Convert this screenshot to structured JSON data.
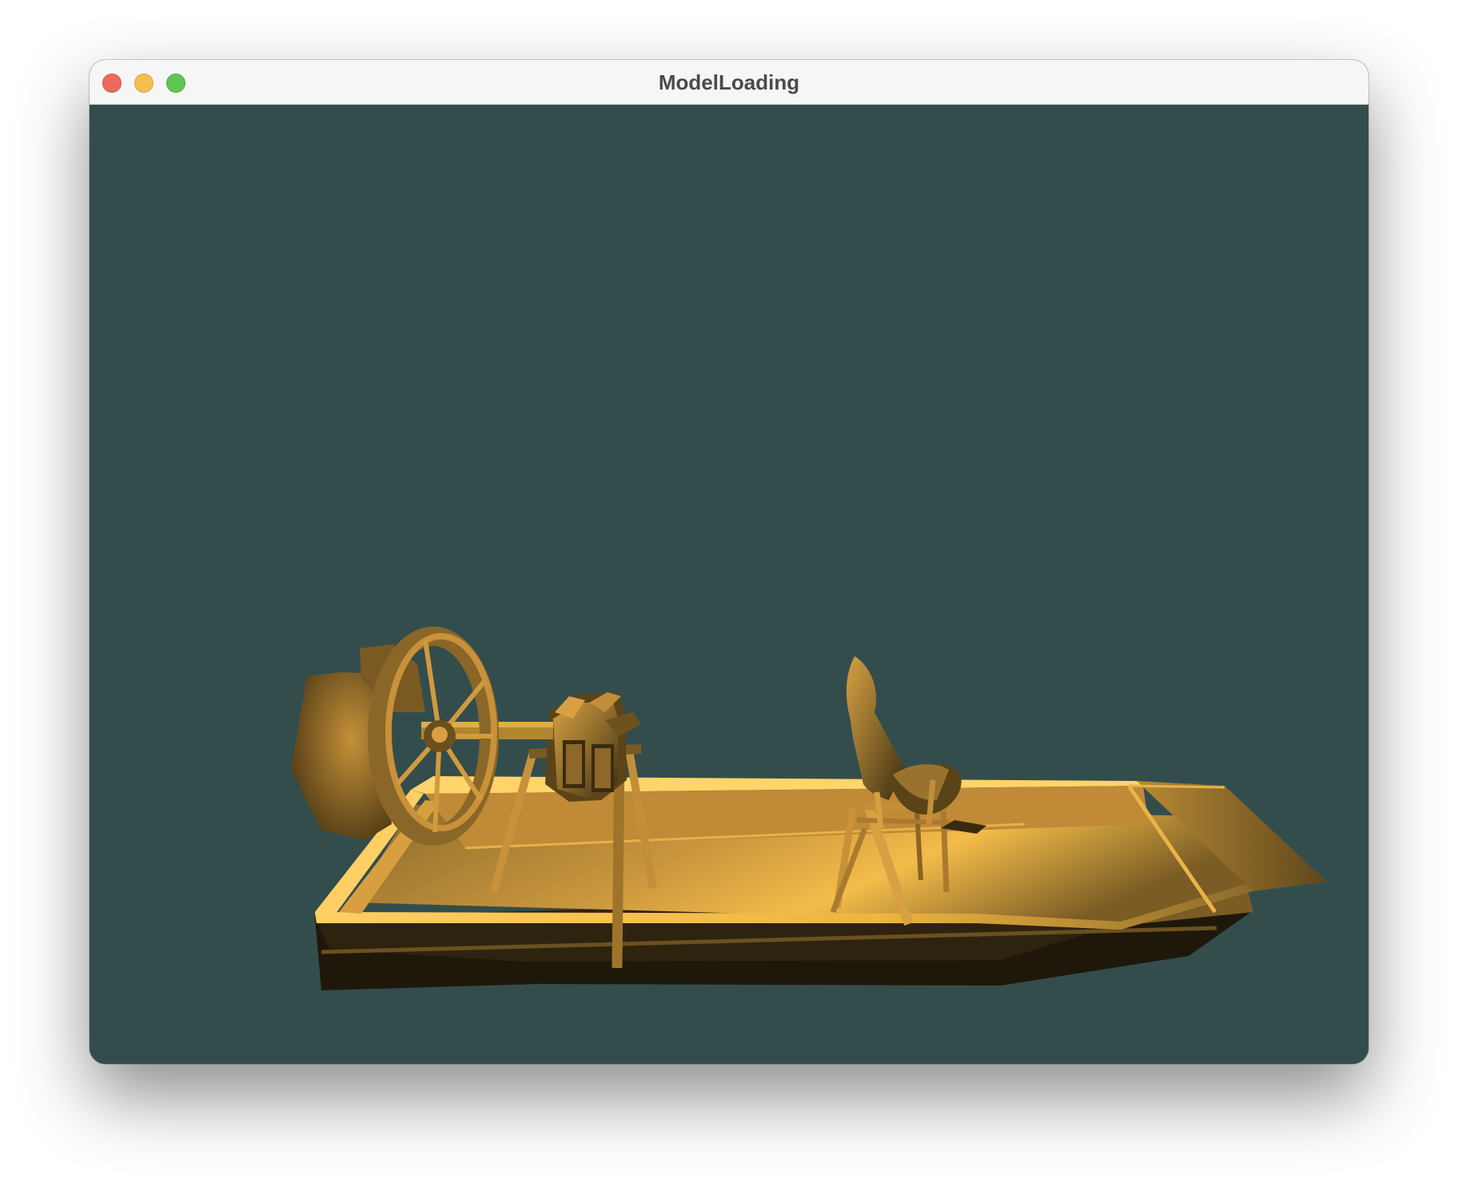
{
  "window": {
    "title": "ModelLoading",
    "controls": {
      "close": "close-button",
      "minimize": "minimize-button",
      "zoom": "zoom-button"
    }
  },
  "scene": {
    "clear_color": "#334d4d",
    "model_color": "#f0b33c",
    "model_name": "airboat"
  }
}
